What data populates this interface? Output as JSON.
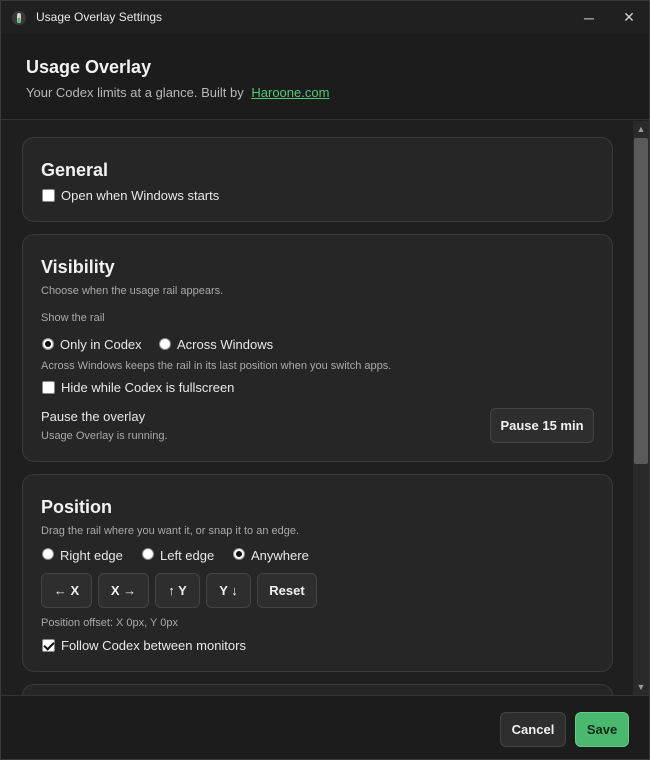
{
  "window": {
    "title": "Usage Overlay Settings",
    "minimize_glyph": "─",
    "close_glyph": "✕"
  },
  "header": {
    "title": "Usage Overlay",
    "subtitle": "Your Codex limits at a glance. Built by",
    "link": "Haroone.com"
  },
  "general": {
    "title": "General",
    "open_on_start": {
      "label": "Open when Windows starts",
      "checked": false
    }
  },
  "visibility": {
    "title": "Visibility",
    "description": "Choose when the usage rail appears.",
    "show_rail_label": "Show the rail",
    "options": [
      {
        "label": "Only in Codex",
        "checked": true
      },
      {
        "label": "Across Windows",
        "checked": false
      }
    ],
    "across_note": "Across Windows keeps the rail in its last position when you switch apps.",
    "hide_fullscreen": {
      "label": "Hide while Codex is fullscreen",
      "checked": false
    },
    "pause_label": "Pause the overlay",
    "pause_status": "Usage Overlay is running.",
    "pause_button": "Pause 15 min"
  },
  "position": {
    "title": "Position",
    "description": "Drag the rail where you want it, or snap it to an edge.",
    "options": [
      {
        "label": "Right edge",
        "checked": false
      },
      {
        "label": "Left edge",
        "checked": false
      },
      {
        "label": "Anywhere",
        "checked": true
      }
    ],
    "buttons": [
      "← X",
      "X →",
      "↑ Y",
      "Y ↓",
      "Reset"
    ],
    "offset_text": "Position offset: X 0px, Y 0px",
    "follow_monitors": {
      "label": "Follow Codex between monitors",
      "checked": true
    }
  },
  "footer": {
    "cancel": "Cancel",
    "save": "Save"
  },
  "scrollbar": {
    "up_glyph": "▲",
    "down_glyph": "▼"
  },
  "colors": {
    "accent": "#4ab86f",
    "link": "#4fc97a",
    "background": "#1f1f1f",
    "card": "#262626"
  }
}
